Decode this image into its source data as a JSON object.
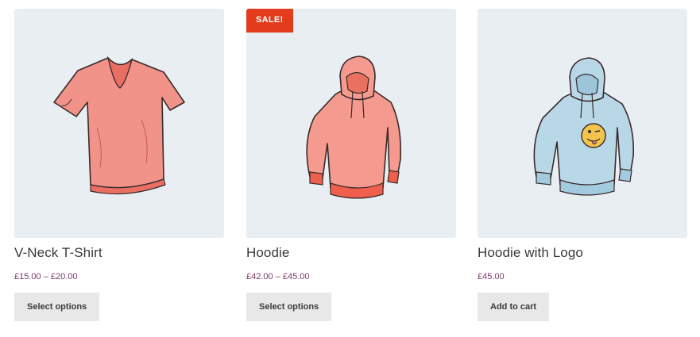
{
  "products": [
    {
      "title": "V-Neck T-Shirt",
      "price": "£15.00 – £20.00",
      "button": "Select options",
      "image": "vneck-tshirt-illustration",
      "color": "#f2938a"
    },
    {
      "title": "Hoodie",
      "price": "£42.00 – £45.00",
      "button": "Select options",
      "badge": "SALE!",
      "image": "hoodie-illustration",
      "color": "#f59a8e"
    },
    {
      "title": "Hoodie with Logo",
      "price": "£45.00",
      "button": "Add to cart",
      "image": "hoodie-with-logo-illustration",
      "color": "#b8d8e8"
    }
  ],
  "colors": {
    "thumb_background": "#e9eef3",
    "sale_badge": "#e23c1c",
    "price": "#7b3a6a",
    "button_background": "#e8e8e8"
  }
}
